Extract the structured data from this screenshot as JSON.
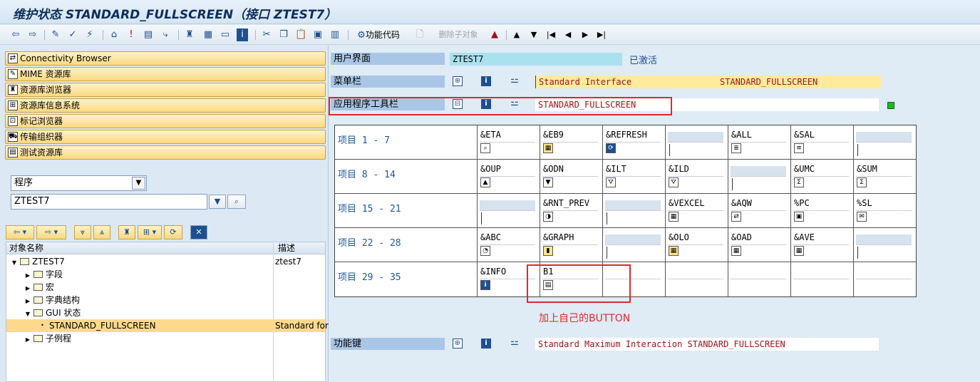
{
  "window": {
    "title": "维护状态 STANDARD_FULLSCREEN（接口 ZTEST7）"
  },
  "toolbar": {
    "function_code_label": "功能代码",
    "delete_child_label": "删除子对象"
  },
  "left": {
    "nav_buttons": [
      "Connectivity Browser",
      "MIME 资源库",
      "资源库浏览器",
      "资源库信息系统",
      "标记浏览器",
      "传输组织器",
      "测试资源库"
    ],
    "object_type": "程序",
    "object_name": "ZTEST7",
    "tree": {
      "col_name": "对象名称",
      "col_desc": "描述",
      "rows": [
        {
          "label": "ZTEST7",
          "desc": "ztest7"
        },
        {
          "label": "字段",
          "desc": ""
        },
        {
          "label": "宏",
          "desc": ""
        },
        {
          "label": "字典结构",
          "desc": ""
        },
        {
          "label": "GUI 状态",
          "desc": ""
        },
        {
          "label": "STANDARD_FULLSCREEN",
          "desc": "Standard for"
        },
        {
          "label": "子例程",
          "desc": ""
        }
      ]
    }
  },
  "right": {
    "user_interface_label": "用户界面",
    "user_interface_value": "ZTEST7",
    "status": "已激活",
    "menubar_label": "菜单栏",
    "menubar_value": "Standard Interface",
    "menubar_value2": "STANDARD_FULLSCREEN",
    "apptoolbar_label": "应用程序工具栏",
    "apptoolbar_value": "STANDARD_FULLSCREEN",
    "function_keys_label": "功能键",
    "function_keys_value": "Standard Maximum Interaction STANDARD_FULLSCREEN",
    "annotation": "加上自己的BUTTON",
    "rows": [
      {
        "label": "项目  1 -  7",
        "cells": [
          "&ETA",
          "&EB9",
          "&REFRESH",
          "",
          "&ALL",
          "&SAL",
          ""
        ]
      },
      {
        "label": "项目  8 - 14",
        "cells": [
          "&OUP",
          "&ODN",
          "&ILT",
          "&ILD",
          "",
          "&UMC",
          "&SUM"
        ]
      },
      {
        "label": "项目 15 - 21",
        "cells": [
          "",
          "&RNT_PREV",
          "",
          "&VEXCEL",
          "&AQW",
          "%PC",
          "%SL"
        ]
      },
      {
        "label": "项目 22 - 28",
        "cells": [
          "&ABC",
          "&GRAPH",
          "",
          "&OLO",
          "&OAD",
          "&AVE",
          ""
        ]
      },
      {
        "label": "项目 29 - 35",
        "cells": [
          "&INFO",
          "B1",
          "",
          "",
          "",
          "",
          ""
        ]
      }
    ]
  },
  "colors": {
    "nav_yellow": "#fbd980",
    "label_blue": "#a9c6e6",
    "value_red": "#a3121d",
    "annotation_red": "#e0282d",
    "status_green": "#1fb81f"
  }
}
